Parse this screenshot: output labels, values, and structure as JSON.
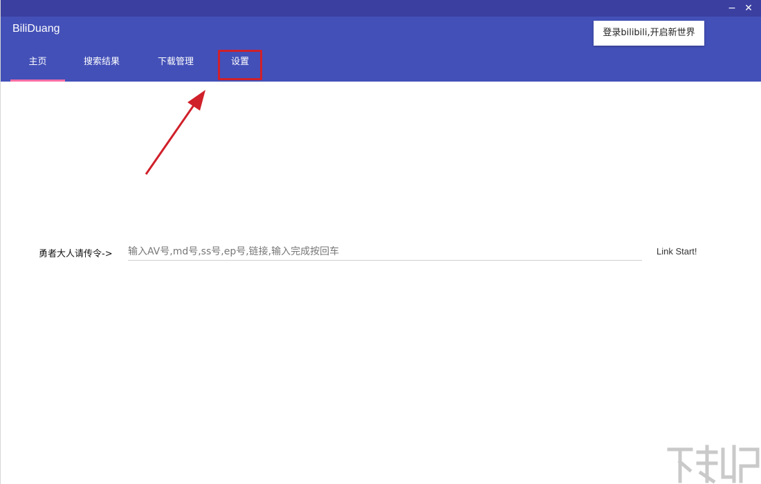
{
  "window": {
    "minimize_glyph": "−",
    "close_glyph": "✕"
  },
  "header": {
    "app_title": "BiliDuang",
    "login_button": "登录bilibili,开启新世界"
  },
  "tabs": [
    {
      "label": "主页",
      "active": true
    },
    {
      "label": "搜索结果",
      "active": false
    },
    {
      "label": "下载管理",
      "active": false
    },
    {
      "label": "设置",
      "active": false
    }
  ],
  "command": {
    "label": "勇者大人请传令->",
    "placeholder": "输入AV号,md号,ss号,ep号,链接,输入完成按回车",
    "value": "",
    "submit_label": "Link Start!"
  },
  "colors": {
    "titlebar": "#3a3fa0",
    "header": "#4350b8",
    "active_tab_underline": "#ff6fa5",
    "annotation_red": "#d0202a"
  }
}
